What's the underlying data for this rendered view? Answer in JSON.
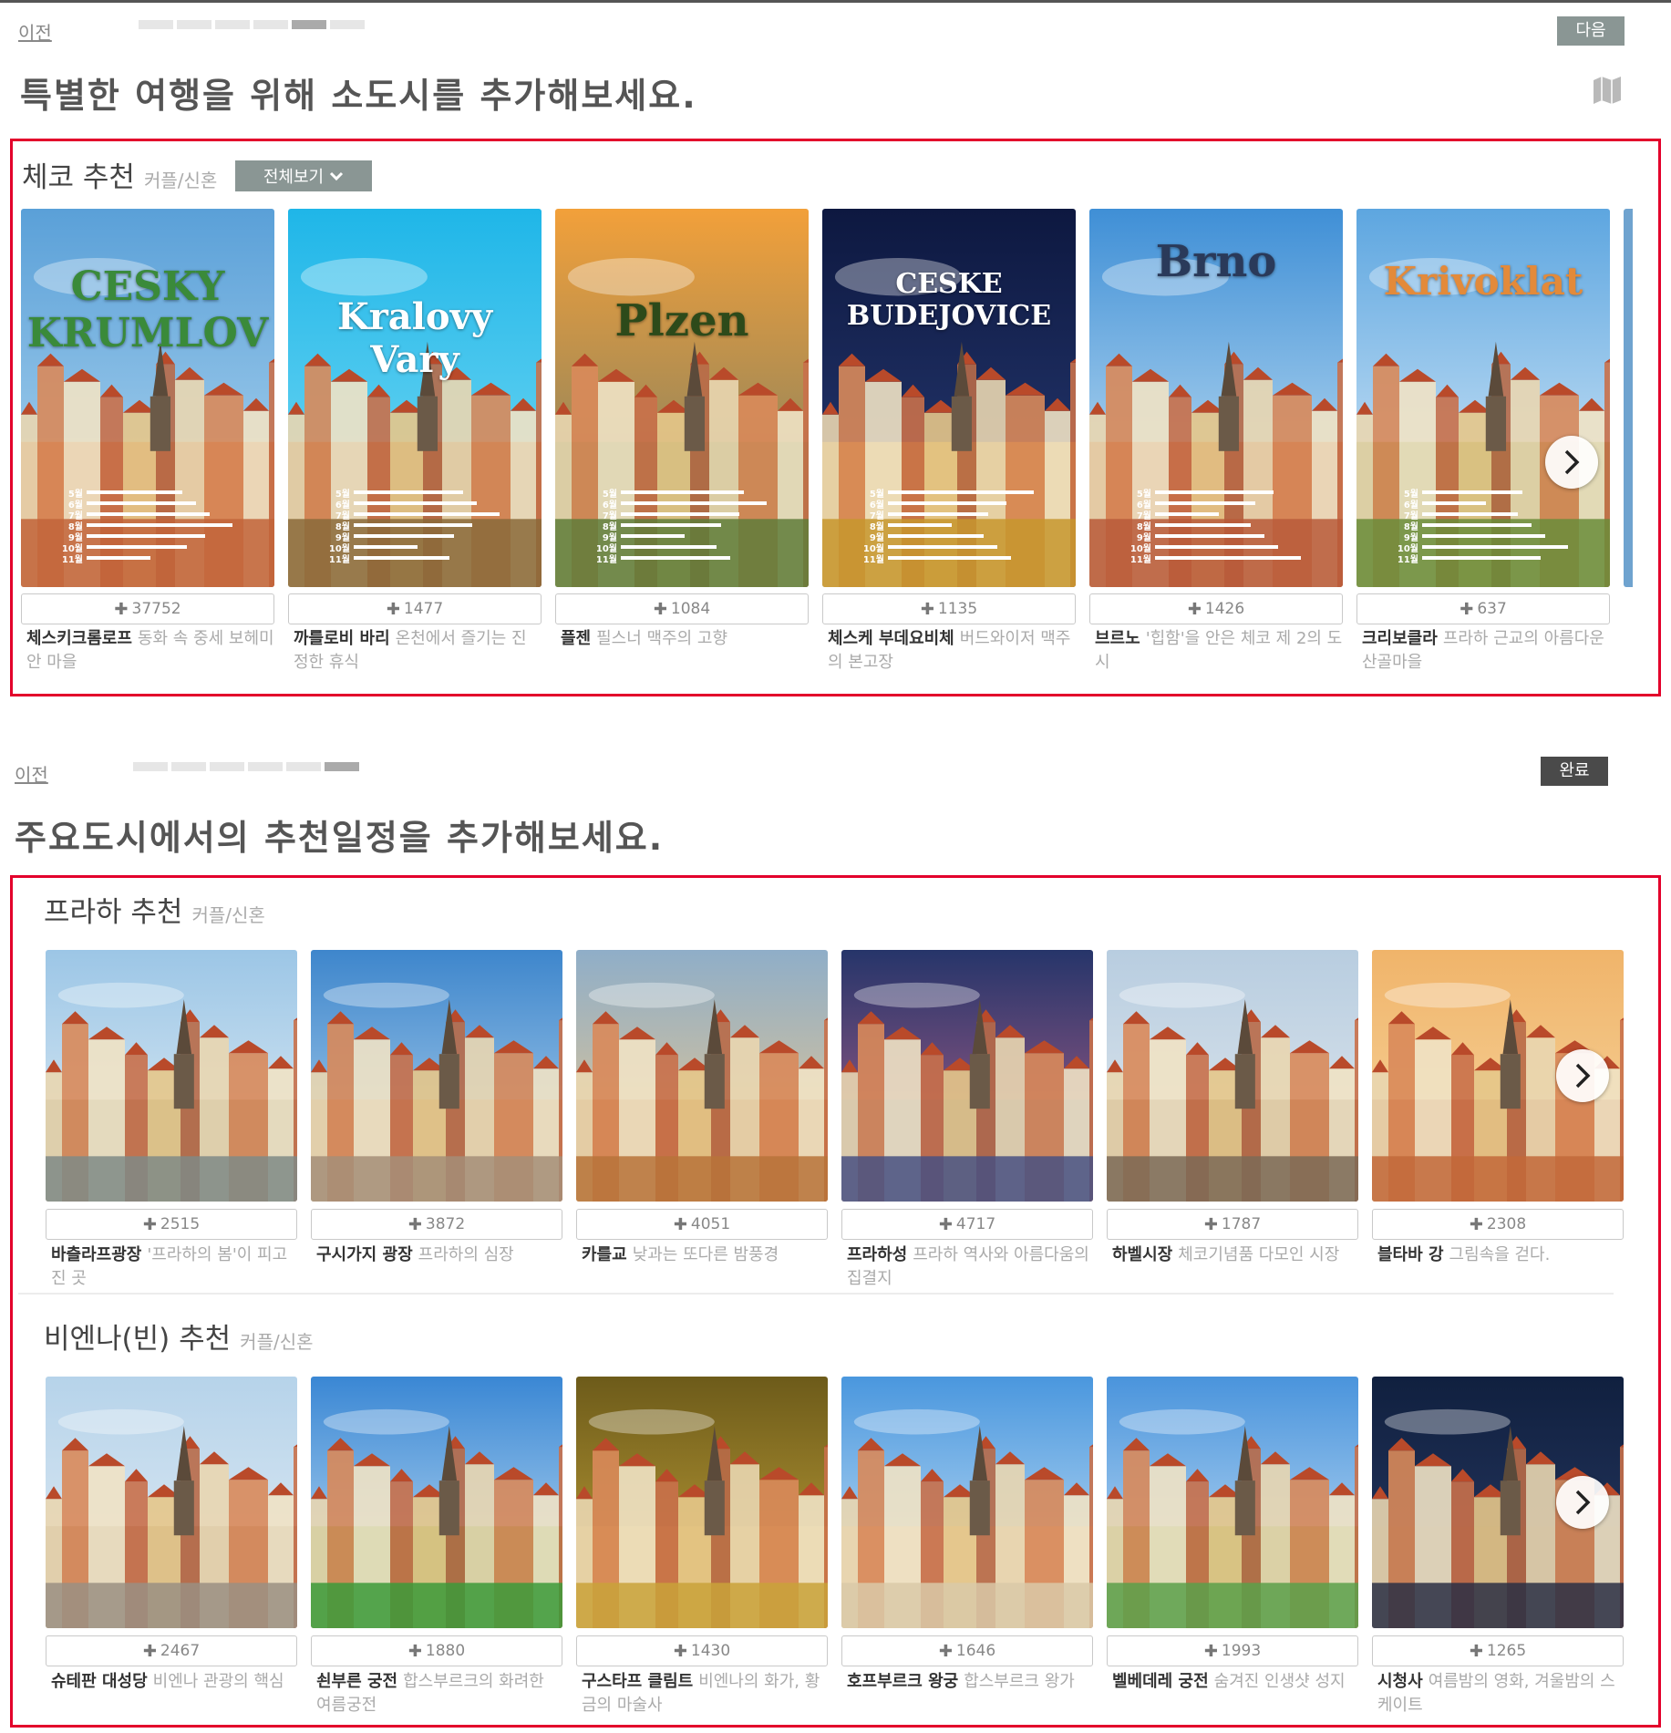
{
  "colors": {
    "accent_red": "#e3002b",
    "next_btn": "#8a9694",
    "done_btn": "#4a4a4a"
  },
  "step1": {
    "prev_label": "이전",
    "next_label": "다음",
    "title": "특별한 여행을 위해 소도시를 추가해보세요.",
    "progress_total": 6,
    "progress_active": 5,
    "section": {
      "title": "체코 추천",
      "subtitle": "커플/신혼",
      "view_all_label": "전체보기",
      "months": [
        "5월",
        "6월",
        "7월",
        "8월",
        "9월",
        "10월",
        "11월"
      ],
      "cards": [
        {
          "name": "체스키크롬로프",
          "desc": "동화 속 중세 보헤미안 마을",
          "count": "37752",
          "art_title": "CESKY KRUMLOV",
          "theme": "krumlov"
        },
        {
          "name": "까를로비 바리",
          "desc": "온천에서 즐기는 진정한 휴식",
          "count": "1477",
          "art_title": "Kralovy Vary",
          "theme": "vary"
        },
        {
          "name": "플젠",
          "desc": "필스너 맥주의 고향",
          "count": "1084",
          "art_title": "Plzen",
          "theme": "plzen"
        },
        {
          "name": "체스케 부데요비체",
          "desc": "버드와이저 맥주의 본고장",
          "count": "1135",
          "art_title": "CESKE BUDEJOVICE",
          "theme": "budejovice"
        },
        {
          "name": "브르노",
          "desc": "'힙함'을 안은 체코 제 2의 도시",
          "count": "1426",
          "art_title": "Brno",
          "theme": "brno"
        },
        {
          "name": "크리보클라",
          "desc": "프라하 근교의 아름다운 산골마을",
          "count": "637",
          "art_title": "Krivoklat",
          "theme": "krivoklat"
        }
      ]
    }
  },
  "step2": {
    "prev_label": "이전",
    "done_label": "완료",
    "title": "주요도시에서의 추천일정을 추가해보세요.",
    "progress_total": 6,
    "progress_active": 6,
    "sections": [
      {
        "title": "프라하 추천",
        "subtitle": "커플/신혼",
        "cards": [
          {
            "name": "바츨라프광장",
            "desc": "'프라하의 봄'이 피고 진 곳",
            "count": "2515",
            "theme": "wenceslas"
          },
          {
            "name": "구시가지 광장",
            "desc": "프라하의 심장",
            "count": "3872",
            "theme": "oldtown"
          },
          {
            "name": "카를교",
            "desc": "낮과는 또다른 밤풍경",
            "count": "4051",
            "theme": "charles"
          },
          {
            "name": "프라하성",
            "desc": "프라하 역사와 아름다움의 집결지",
            "count": "4717",
            "theme": "castle"
          },
          {
            "name": "하벨시장",
            "desc": "체코기념품 다모인 시장",
            "count": "1787",
            "theme": "havel"
          },
          {
            "name": "블타바 강",
            "desc": "그림속을 걷다.",
            "count": "2308",
            "theme": "vltava"
          }
        ]
      },
      {
        "title": "비엔나(빈) 추천",
        "subtitle": "커플/신혼",
        "cards": [
          {
            "name": "슈테판 대성당",
            "desc": "비엔나 관광의 핵심",
            "count": "2467",
            "theme": "stephan"
          },
          {
            "name": "쇤부른 궁전",
            "desc": "합스부르크의 화려한 여름궁전",
            "count": "1880",
            "theme": "schonbrunn"
          },
          {
            "name": "구스타프 클림트",
            "desc": "비엔나의 화가, 황금의 마술사",
            "count": "1430",
            "theme": "klimt"
          },
          {
            "name": "호프부르크 왕궁",
            "desc": "합스부르크 왕가",
            "count": "1646",
            "theme": "hofburg"
          },
          {
            "name": "벨베데레 궁전",
            "desc": "숨겨진 인생샷 성지",
            "count": "1993",
            "theme": "belvedere"
          },
          {
            "name": "시청사",
            "desc": "여름밤의 영화, 겨울밤의 스케이트",
            "count": "1265",
            "theme": "rathaus"
          }
        ]
      }
    ]
  }
}
